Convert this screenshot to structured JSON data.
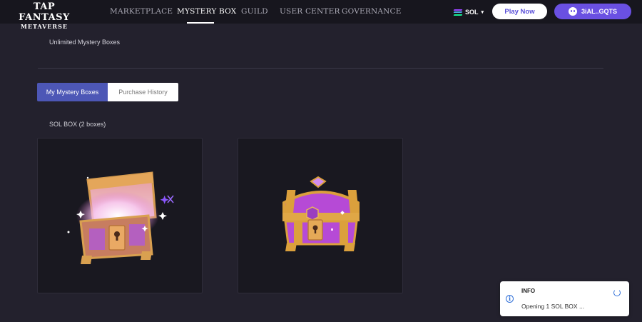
{
  "brand": {
    "line1": "TAP FANTASY",
    "line2": "METAVERSE"
  },
  "nav": {
    "items": [
      {
        "label": "MARKETPLACE"
      },
      {
        "label": "MYSTERY BOX"
      },
      {
        "label": "GUILD"
      },
      {
        "label": "USER CENTER"
      },
      {
        "label": "GOVERNANCE"
      }
    ],
    "active": "MYSTERY BOX"
  },
  "header": {
    "chain_label": "SOL",
    "chain_icon": "solana-icon",
    "caret": "▾",
    "play_label": "Play Now",
    "wallet_label": "3iAL..GQTS",
    "wallet_icon": "ghost-avatar-icon"
  },
  "page": {
    "subtitle": "Unlimited Mystery Boxes",
    "tabs": [
      {
        "label": "My Mystery Boxes",
        "active": true
      },
      {
        "label": "Purchase History",
        "active": false
      }
    ],
    "section_label": "SOL BOX (2 boxes)"
  },
  "boxes": [
    {
      "image": "opened-treasure-chest"
    },
    {
      "image": "closed-treasure-chest"
    }
  ],
  "toast": {
    "icon": "info-icon",
    "title": "INFO",
    "message": "Opening 1 SOL BOX ...",
    "status": "loading"
  },
  "colors": {
    "background": "#23212d",
    "header": "#17161e",
    "accent": "#6a50e2",
    "tab_active": "#4d57b6",
    "info": "#2f6fd8"
  }
}
